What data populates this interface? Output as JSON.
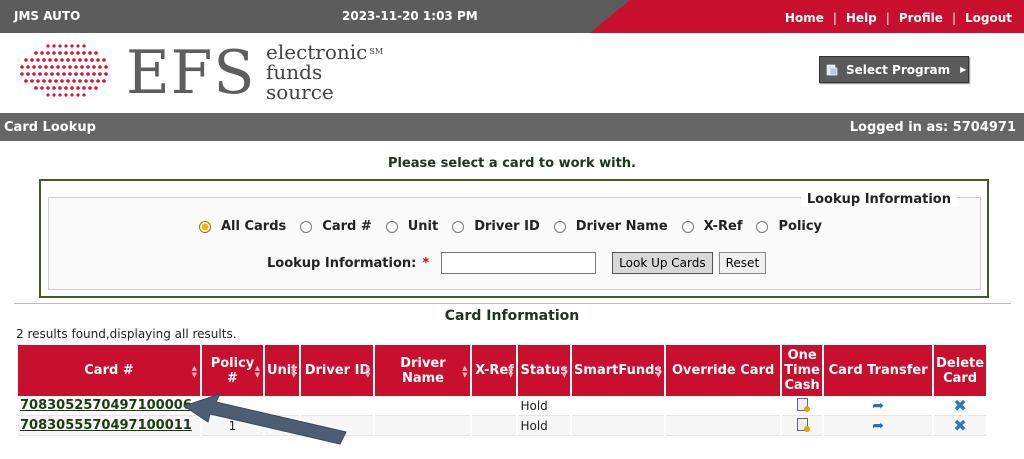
{
  "topbar": {
    "app_name": "JMS AUTO",
    "datetime": "2023-11-20 1:03 PM",
    "nav": [
      "Home",
      "Help",
      "Profile",
      "Logout"
    ],
    "accent_color": "#c8102e"
  },
  "logo": {
    "wordmark": "EFS",
    "line1": "electronic",
    "line2": "funds",
    "line3": "source",
    "mark": "SM"
  },
  "select_program": {
    "label": "Select Program",
    "icon": "program-icon"
  },
  "section": {
    "title": "Card Lookup",
    "logged_in": "Logged in as: 5704971"
  },
  "prompt": "Please select a card to work with.",
  "lookup": {
    "legend": "Lookup Information",
    "options": [
      "All Cards",
      "Card #",
      "Unit",
      "Driver ID",
      "Driver Name",
      "X-Ref",
      "Policy"
    ],
    "selected": "All Cards",
    "field_label": "Lookup Information:",
    "required_mark": "*",
    "value": "",
    "submit_label": "Look Up Cards",
    "reset_label": "Reset"
  },
  "card_info": {
    "title": "Card Information",
    "results_text": "2 results found,displaying all results.",
    "columns": [
      "Card #",
      "Policy #",
      "Unit",
      "Driver ID",
      "Driver Name",
      "X-Ref",
      "Status",
      "SmartFunds",
      "Override Card",
      "One Time Cash",
      "Card Transfer",
      "Delete Card"
    ],
    "rows": [
      {
        "card": "7083052570497100006",
        "policy": "",
        "unit": "",
        "driver_id": "",
        "driver_name": "",
        "xref": "",
        "status": "Hold",
        "smartfunds": "",
        "override": ""
      },
      {
        "card": "7083055570497100011",
        "policy": "1",
        "unit": "",
        "driver_id": "",
        "driver_name": "",
        "xref": "",
        "status": "Hold",
        "smartfunds": "",
        "override": ""
      }
    ]
  }
}
